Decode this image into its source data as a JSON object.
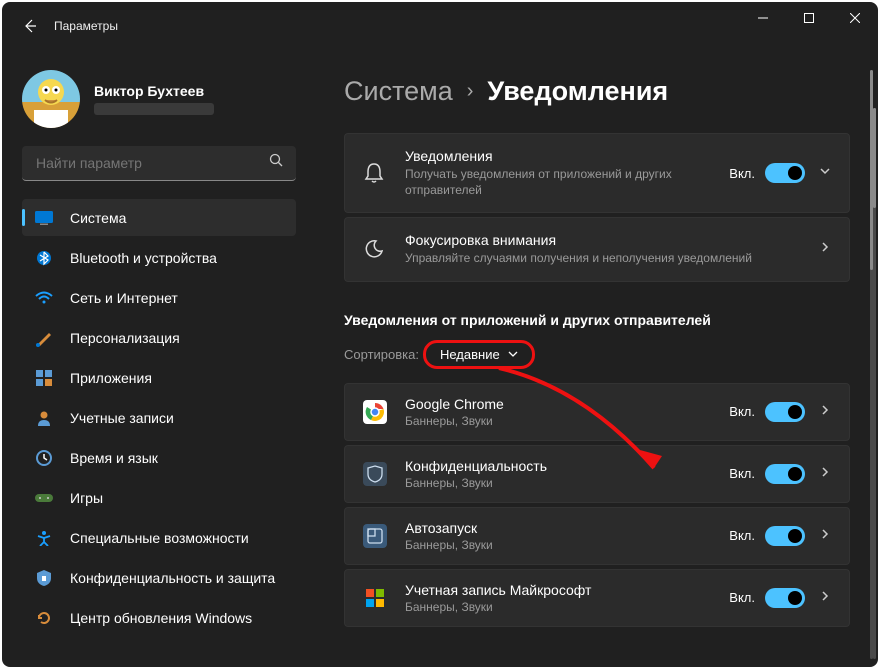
{
  "titlebar": {
    "title": "Параметры"
  },
  "user": {
    "name": "Виктор Бухтеев"
  },
  "search": {
    "placeholder": "Найти параметр"
  },
  "nav": {
    "items": [
      {
        "label": "Система"
      },
      {
        "label": "Bluetooth и устройства"
      },
      {
        "label": "Сеть и Интернет"
      },
      {
        "label": "Персонализация"
      },
      {
        "label": "Приложения"
      },
      {
        "label": "Учетные записи"
      },
      {
        "label": "Время и язык"
      },
      {
        "label": "Игры"
      },
      {
        "label": "Специальные возможности"
      },
      {
        "label": "Конфиденциальность и защита"
      },
      {
        "label": "Центр обновления Windows"
      }
    ]
  },
  "breadcrumb": {
    "parent": "Система",
    "current": "Уведомления"
  },
  "main": {
    "cards": [
      {
        "title": "Уведомления",
        "sub": "Получать уведомления от приложений и других отправителей",
        "state": "Вкл."
      },
      {
        "title": "Фокусировка внимания",
        "sub": "Управляйте случаями получения и неполучения уведомлений"
      }
    ],
    "section_title": "Уведомления от приложений и других отправителей",
    "sort": {
      "label": "Сортировка:",
      "value": "Недавние"
    },
    "apps": [
      {
        "title": "Google Chrome",
        "sub": "Баннеры, Звуки",
        "state": "Вкл."
      },
      {
        "title": "Конфиденциальность",
        "sub": "Баннеры, Звуки",
        "state": "Вкл."
      },
      {
        "title": "Автозапуск",
        "sub": "Баннеры, Звуки",
        "state": "Вкл."
      },
      {
        "title": "Учетная запись Майкрософт",
        "sub": "Баннеры, Звуки",
        "state": "Вкл."
      }
    ]
  }
}
